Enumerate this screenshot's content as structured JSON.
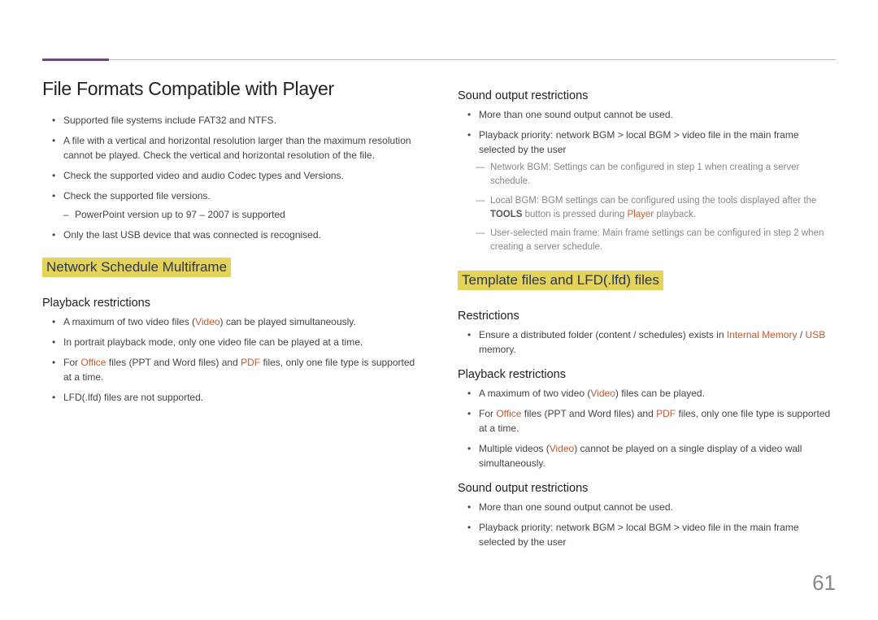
{
  "title": "File Formats Compatible with Player",
  "intro": {
    "i0": "Supported file systems include FAT32 and NTFS.",
    "i1": "A file with a vertical and horizontal resolution larger than the maximum resolution cannot be played. Check the vertical and horizontal resolution of the file.",
    "i2": "Check the supported video and audio Codec types and Versions.",
    "i3": "Check the supported file versions.",
    "i3_sub": "PowerPoint version up to 97 – 2007 is supported",
    "i4": "Only the last USB device that was connected is recognised."
  },
  "left": {
    "section_title": "Network Schedule Multiframe",
    "playback_h": "Playback restrictions",
    "p0_a": "A maximum of two video files (",
    "p0_hl": "Video",
    "p0_b": ") can be played simultaneously.",
    "p1": "In portrait playback mode, only one video file can be played at a time.",
    "p2_a": "For ",
    "p2_hl1": "Office",
    "p2_b": " files (PPT and Word files) and ",
    "p2_hl2": "PDF",
    "p2_c": " files, only one file type is supported at a time.",
    "p3": "LFD(.lfd) files are not supported."
  },
  "right": {
    "sound_h": "Sound output restrictions",
    "s0": "More than one sound output cannot be used.",
    "s1": "Playback priority: network BGM > local BGM > video file in the main frame selected by the user",
    "s1_d0": "Network BGM: Settings can be configured in step 1 when creating a server schedule.",
    "s1_d1_a": "Local BGM: BGM settings can be configured using the tools displayed after the ",
    "s1_d1_tools": "TOOLS",
    "s1_d1_b": " button is pressed during ",
    "s1_d1_hl": "Player",
    "s1_d1_c": " playback.",
    "s1_d2": "User-selected main frame: Main frame settings can be configured in step 2 when creating a server schedule.",
    "section_title": "Template files and LFD(.lfd) files",
    "restr_h": "Restrictions",
    "r0_a": "Ensure a distributed folder (content / schedules) exists in ",
    "r0_hl1": "Internal Memory",
    "r0_sep": " / ",
    "r0_hl2": "USB",
    "r0_b": " memory.",
    "play_h": "Playback restrictions",
    "pb0_a": "A maximum of two video (",
    "pb0_hl": "Video",
    "pb0_b": ") files can be played.",
    "pb1_a": "For ",
    "pb1_hl1": "Office",
    "pb1_b": " files (PPT and Word files) and ",
    "pb1_hl2": "PDF",
    "pb1_c": " files, only one file type is supported at a time.",
    "pb2_a": "Multiple videos (",
    "pb2_hl": "Video",
    "pb2_b": ") cannot be played on a single display of a video wall simultaneously.",
    "sound2_h": "Sound output restrictions",
    "so0": "More than one sound output cannot be used.",
    "so1": "Playback priority: network BGM > local BGM > video file in the main frame selected by the user"
  },
  "page_number": "61"
}
